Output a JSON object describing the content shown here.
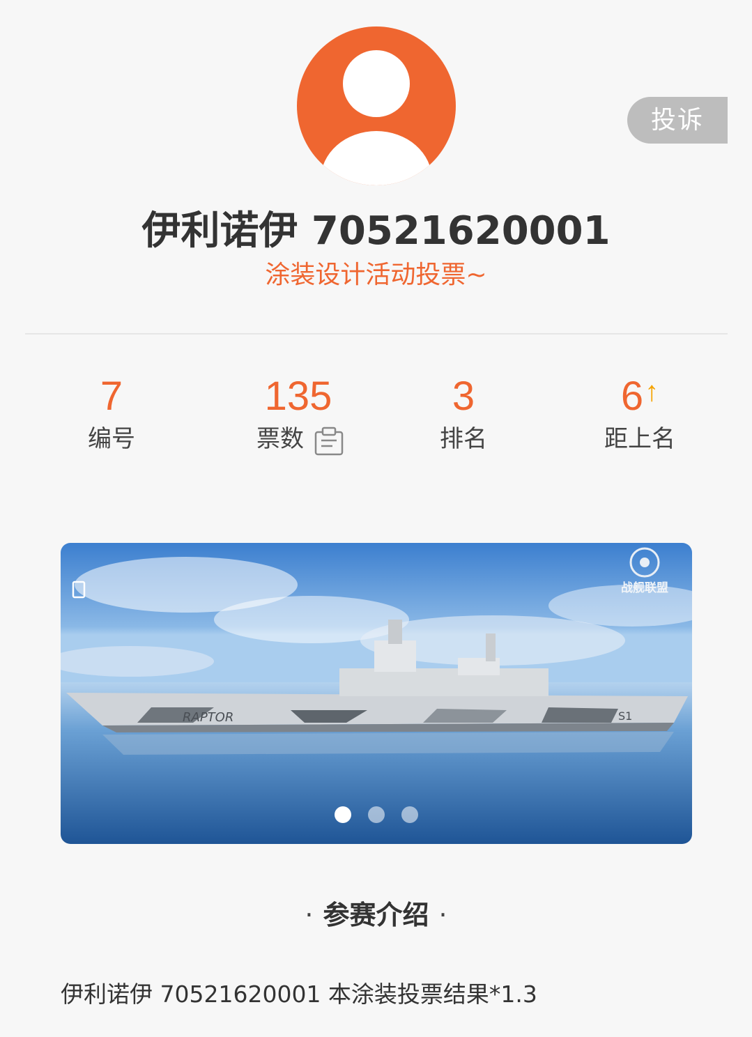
{
  "header": {
    "report_label": "投诉",
    "name": "伊利诺伊 70521620001",
    "subtitle": "涂装设计活动投票~"
  },
  "stats": [
    {
      "value": "7",
      "label": "编号"
    },
    {
      "value": "135",
      "label": "票数"
    },
    {
      "value": "3",
      "label": "排名"
    },
    {
      "value": "6",
      "label": "距上名"
    }
  ],
  "banner": {
    "ship_text_left": "RAPTOR",
    "ship_text_right": "S1",
    "watermark": "战舰联盟",
    "total_slides": 3,
    "active_slide": 1
  },
  "section": {
    "title": "参赛介绍",
    "bullet": "·"
  },
  "intro": {
    "text": "伊利诺伊 70521620001 本涂装投票结果*1.3"
  },
  "colors": {
    "accent": "#ef6630",
    "arrow": "#f5a300",
    "report_bg": "#bdbdbd"
  },
  "icons": {
    "avatar": "user-avatar-icon",
    "votes": "clipboard-icon",
    "rank_change": "arrow-up-icon"
  }
}
